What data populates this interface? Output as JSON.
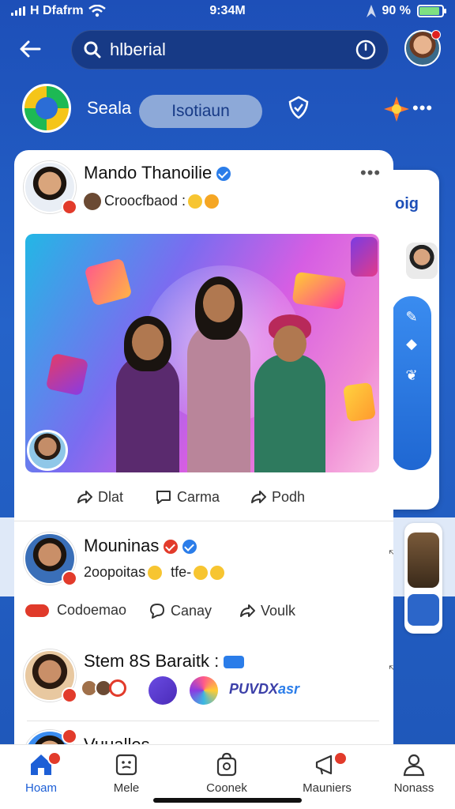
{
  "status_bar": {
    "carrier": "H Dfafrm",
    "time": "9:34M",
    "battery": "90 %",
    "battery_level": 0.9
  },
  "header": {
    "search_value": "hlberial"
  },
  "tab_row": {
    "label": "Seala",
    "active_tab": "Isotiaun"
  },
  "side_panel": {
    "pill_text": "oig"
  },
  "posts": [
    {
      "author": "Mando Thanoilie",
      "subtitle": "Croocfbaod :",
      "actions": [
        "Dlat",
        "Carma",
        "Podh"
      ]
    },
    {
      "author": "Mouninas",
      "subtitle": "2oopoitas",
      "subtitle_extra": "tfe-",
      "actions": [
        "Codoemao",
        "Canay",
        "Voulk"
      ]
    },
    {
      "author": "Stem 8S Baraitk :",
      "brand": "PUVDX",
      "brand_suffix": "asr"
    },
    {
      "author": "Vuualles"
    }
  ],
  "bottom_nav": {
    "items": [
      {
        "label": "Hoam",
        "icon": "home-icon"
      },
      {
        "label": "Mele",
        "icon": "face-icon"
      },
      {
        "label": "Coonek",
        "icon": "bag-icon"
      },
      {
        "label": "Mauniers",
        "icon": "megaphone-icon"
      },
      {
        "label": "Nonass",
        "icon": "profile-icon"
      }
    ]
  },
  "colors": {
    "brand_blue": "#1d5fd6",
    "badge_red": "#e23b2b",
    "verified_blue": "#2b7de9"
  }
}
